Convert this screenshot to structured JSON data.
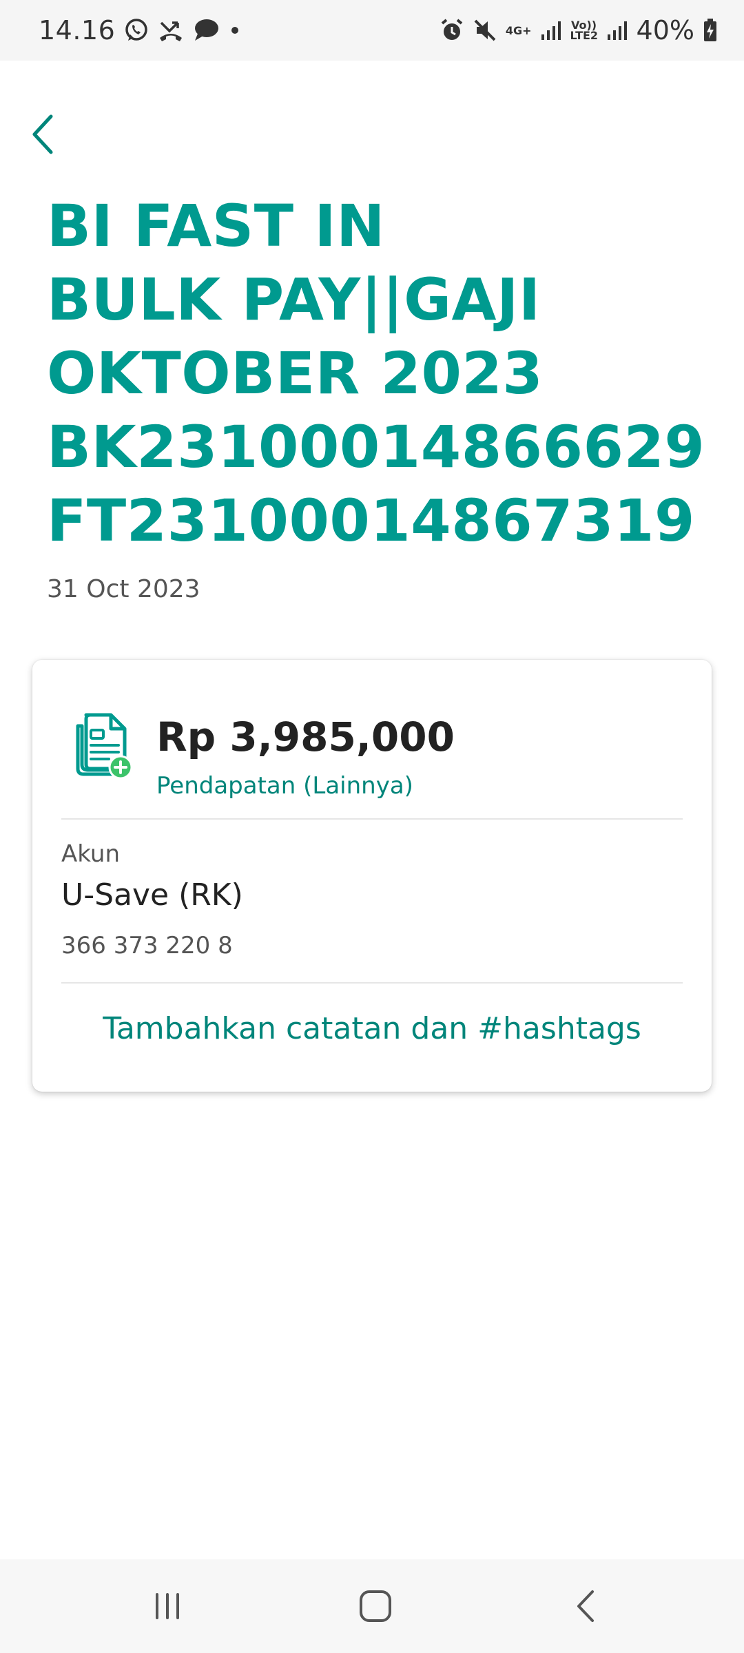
{
  "status_bar": {
    "time": "14.16",
    "battery_percent": "40%",
    "network_label": "4G+",
    "volte_label": "Vo)) LTE2",
    "left_icons": [
      "whatsapp-icon",
      "missed-call-icon",
      "chat-bubble-icon",
      "dot-icon"
    ],
    "right_icons": [
      "alarm-icon",
      "mute-icon",
      "network-4g-icon",
      "signal-icon",
      "volte-icon",
      "signal-icon",
      "battery-charging-icon"
    ]
  },
  "header": {
    "back_icon": "chevron-left-icon",
    "title_lines": [
      "BI FAST IN",
      "BULK PAY||GAJI",
      "OKTOBER 2023",
      "BK23100014866629",
      "FT23100014867319"
    ],
    "date": "31 Oct 2023"
  },
  "transaction": {
    "icon": "income-document-plus-icon",
    "amount": "Rp 3,985,000",
    "category": "Pendapatan (Lainnya)",
    "account_label": "Akun",
    "account_name": "U-Save (RK)",
    "account_number": "366 373 220 8",
    "add_note_label": "Tambahkan catatan dan #hashtags"
  },
  "nav_bar": {
    "buttons": [
      "recent-apps-icon",
      "home-icon",
      "back-icon"
    ]
  },
  "colors": {
    "accent": "#009a8f",
    "link": "#00857a",
    "badge_green": "#3cc36a",
    "text_dark": "#222222",
    "text_muted": "#555555"
  }
}
